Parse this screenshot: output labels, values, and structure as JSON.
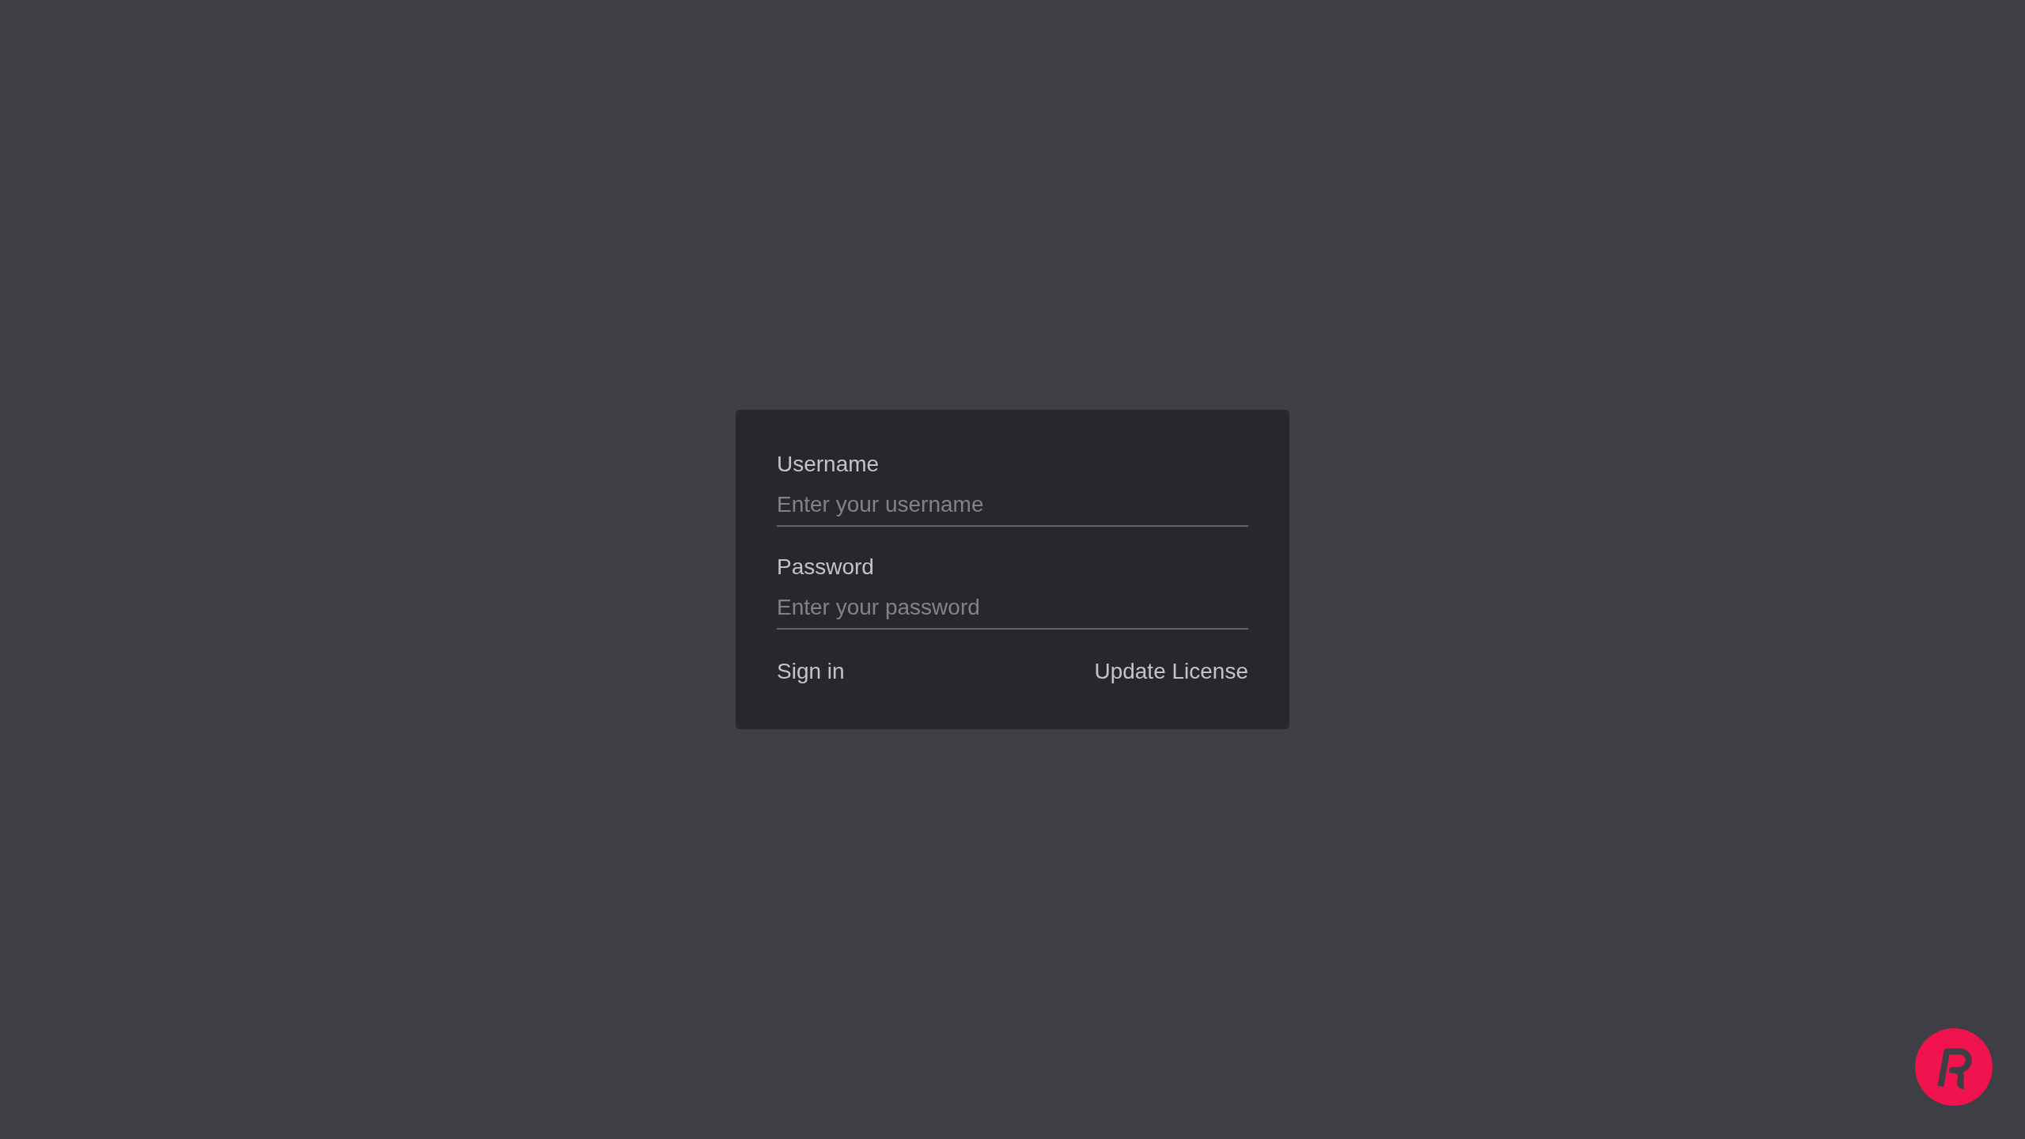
{
  "login_form": {
    "fields": [
      {
        "label": "Username",
        "placeholder": "Enter your username"
      },
      {
        "label": "Password",
        "placeholder": "Enter your password"
      }
    ],
    "actions": [
      "Sign in",
      "Update License"
    ]
  }
}
